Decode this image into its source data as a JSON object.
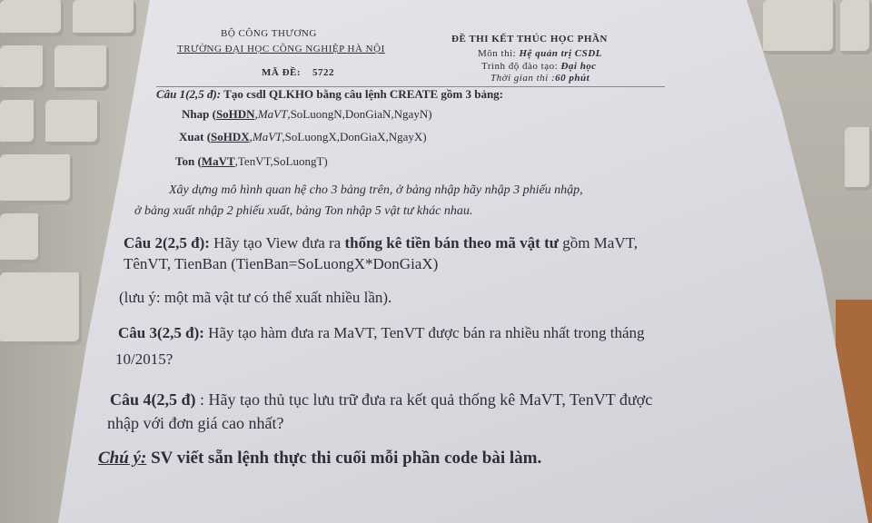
{
  "header": {
    "ministry": "BỘ CÔNG THƯƠNG",
    "school": "TRƯỜNG ĐẠI HỌC CÔNG NGHIỆP HÀ NỘI",
    "code_label": "MÃ ĐỀ:",
    "code_value": "5722",
    "exam_title": "ĐỀ THI KẾT THÚC HỌC PHẦN",
    "subject_label": "Môn thi:",
    "subject_value": "Hệ quản trị CSDL",
    "level_label": "Trình độ đào tạo:",
    "level_value": "Đại học",
    "time_label": "Thời gian thi :",
    "time_value": "60 phút"
  },
  "q1": {
    "title": "Câu 1(2,5 đ):",
    "text": " Tạo csdl QLKHO bằng câu lệnh CREATE gồm 3 bảng:",
    "nhap": {
      "name": "Nhap (",
      "key": "SoHDN",
      "sep": ",",
      "fk": "MaVT",
      "rest": ",SoLuongN,DonGiaN,NgayN)"
    },
    "xuat": {
      "name": "Xuat (",
      "key": "SoHDX",
      "sep": ",",
      "fk": "MaVT",
      "rest": ",SoLuongX,DonGiaX,NgayX)"
    },
    "ton": {
      "name": "Ton (",
      "key": "MaVT",
      "rest": ",TenVT,SoLuongT)"
    },
    "note_line1": "Xây dựng mô hình quan hệ cho 3 bảng trên, ở bảng nhập hãy nhập 3 phiếu nhập,",
    "note_line2": "ở  bảng xuất nhập 2 phiếu xuất, bảng Ton  nhập 5 vật tư khác nhau."
  },
  "q2": {
    "title": "Câu 2(2,5 đ):",
    "text_a": " Hãy tạo View đưa ra ",
    "text_bold": "thống kê tiền bán theo mã vật tư",
    "text_b": " gồm MaVT,",
    "line2": "TênVT, TienBan (TienBan=SoLuongX*DonGiaX)",
    "note": "(lưu ý: một mã vật tư có thể xuất nhiều lần)."
  },
  "q3": {
    "title": "Câu 3(2,5 đ):",
    "line1": " Hãy tạo hàm đưa ra MaVT, TenVT được bán ra nhiều nhất trong tháng",
    "line2": "10/2015?"
  },
  "q4": {
    "title": "Câu 4(2,5 đ)",
    "line1": " : Hãy tạo thủ tục lưu trữ đưa ra kết quả thống kê MaVT, TenVT được",
    "line2": "nhập với đơn giá cao nhất?"
  },
  "footer": {
    "label": "Chú ý:",
    "text": " SV viết sẵn lệnh thực thi cuối mỗi phần code bài làm."
  }
}
